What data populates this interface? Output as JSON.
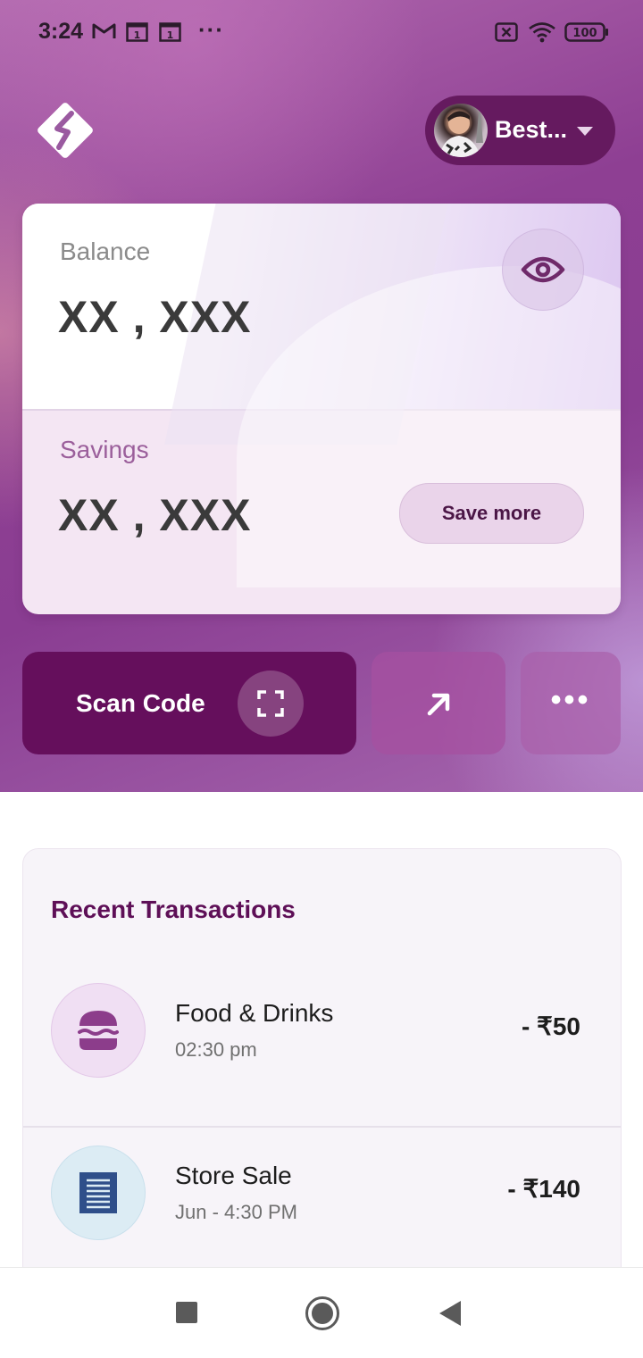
{
  "status_bar": {
    "time": "3:24",
    "icons": [
      "gmail-icon",
      "calendar-icon",
      "calendar-icon",
      "more-notifications-icon",
      "no-sim-icon",
      "wifi-icon",
      "battery-icon"
    ],
    "overflow_dots": "···",
    "battery_level": "100"
  },
  "header": {
    "logo": "app-logo-icon",
    "account": {
      "name": "Best...",
      "avatar": "avatar-photo"
    }
  },
  "balance_card": {
    "balance_label": "Balance",
    "balance_value": "XX , XXX",
    "visibility_icon": "eye-icon",
    "savings_label": "Savings",
    "savings_value": "XX , XXX",
    "save_more_label": "Save more"
  },
  "actions": {
    "scan_label": "Scan Code",
    "scan_icon": "scan-frame-icon",
    "send_icon": "arrow-up-right-icon",
    "more_label": "•••"
  },
  "transactions": {
    "title": "Recent Transactions",
    "items": [
      {
        "name": "Food & Drinks",
        "time": "02:30 pm",
        "amount": "- ₹50",
        "icon": "burger-icon"
      },
      {
        "name": "Store Sale",
        "time": "Jun - 4:30 PM",
        "amount": "- ₹140",
        "icon": "receipt-icon"
      }
    ]
  },
  "nav_bar": {
    "buttons": [
      "recents-square-icon",
      "home-circle-icon",
      "back-triangle-icon"
    ]
  },
  "colors": {
    "brand_dark": "#650f5c",
    "title_purple": "#5e0f57",
    "savings_bg": "#f4e6f3"
  }
}
